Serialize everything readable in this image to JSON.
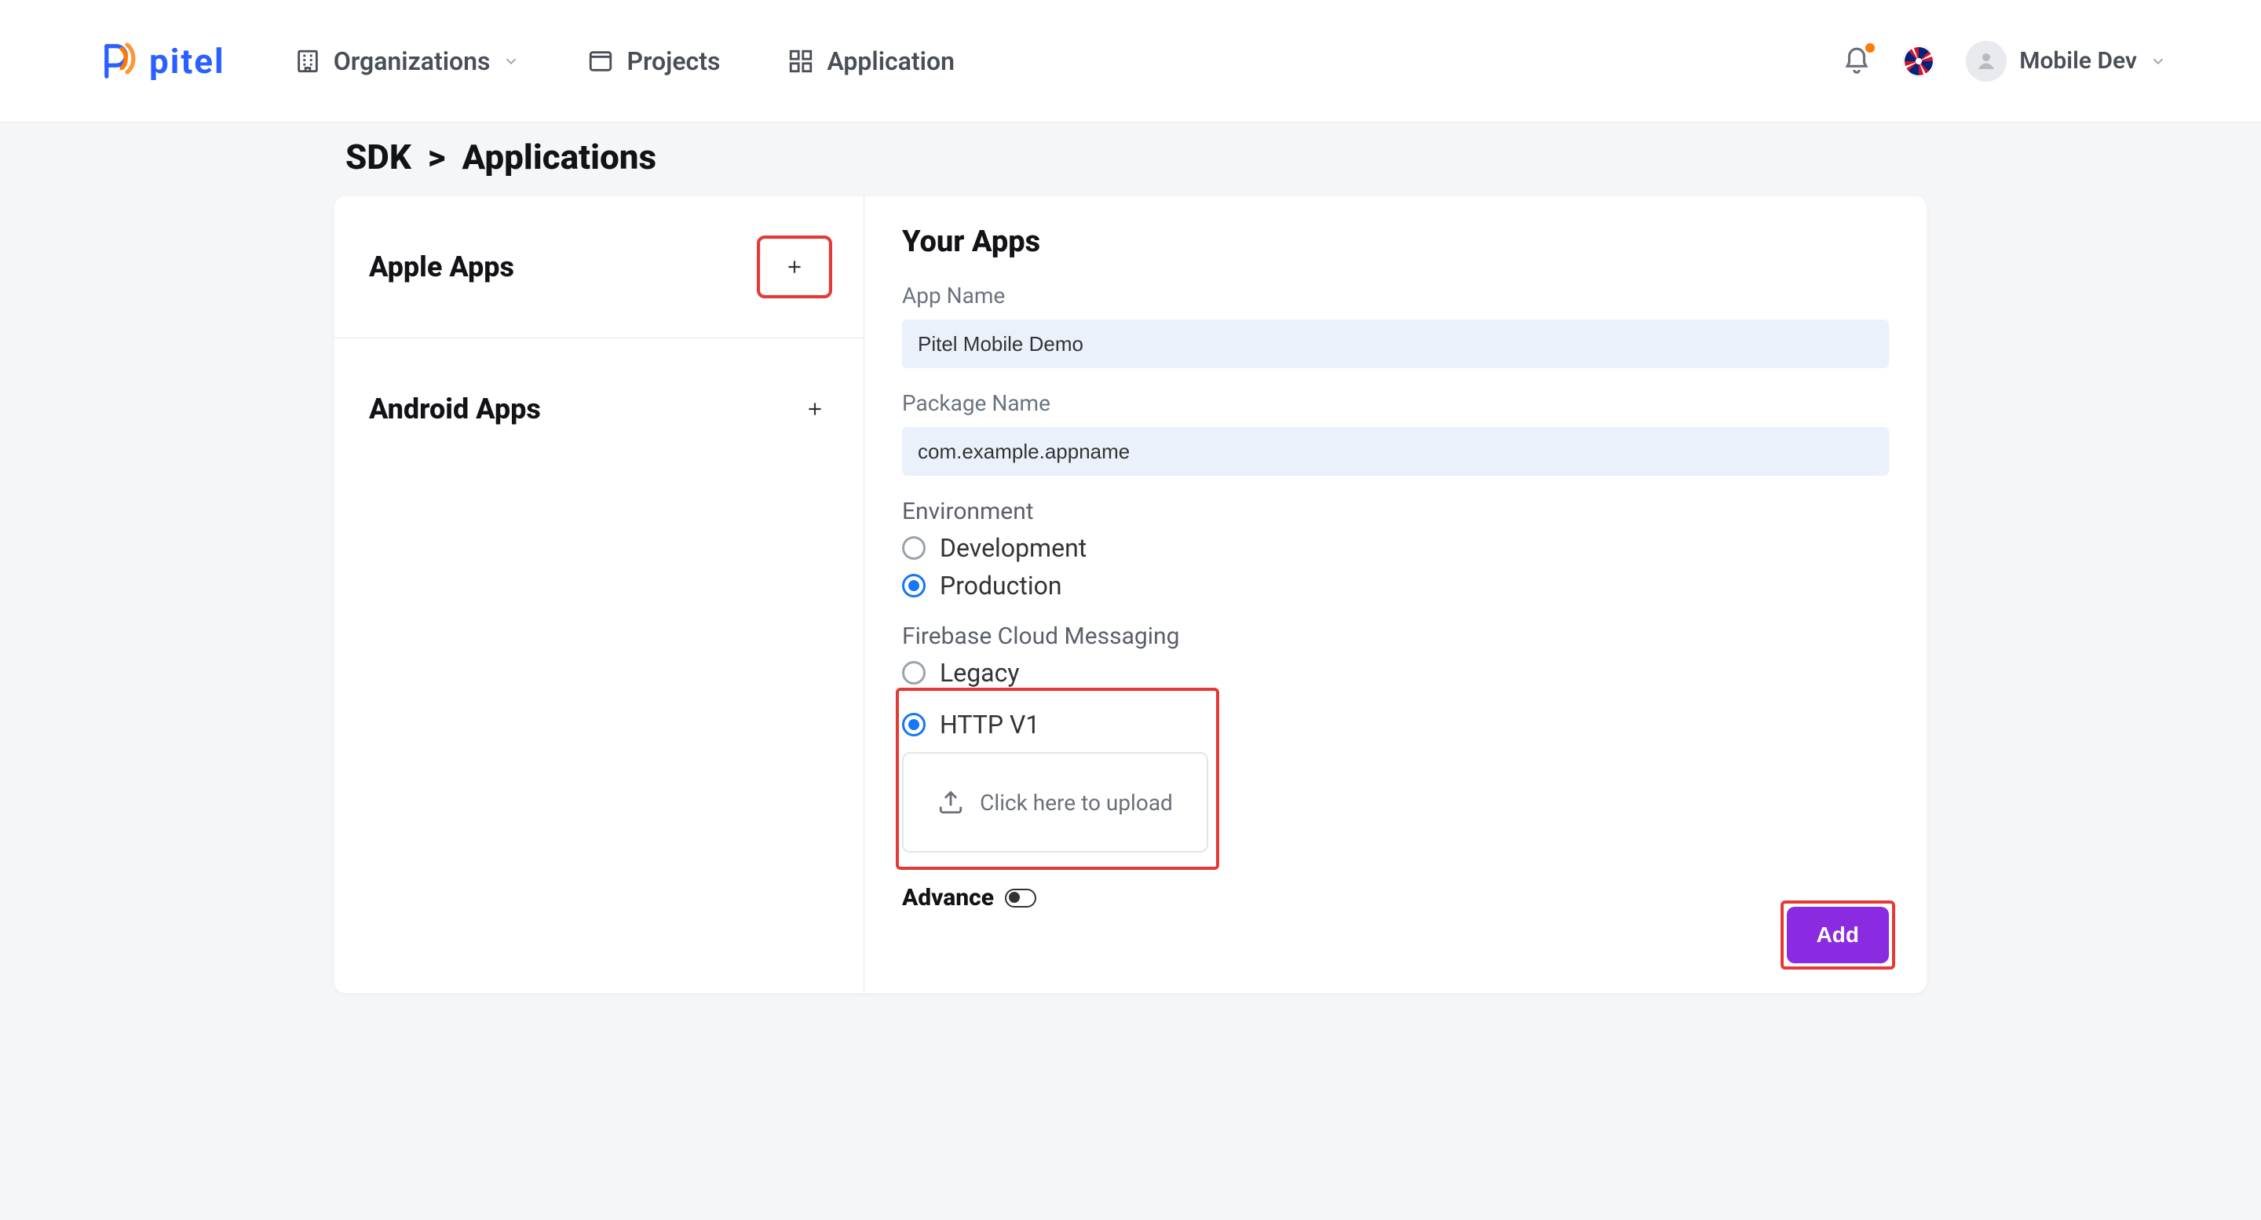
{
  "brand": {
    "name": "pitel"
  },
  "nav": {
    "organizations": "Organizations",
    "projects": "Projects",
    "application": "Application"
  },
  "user": {
    "display_name": "Mobile Dev"
  },
  "breadcrumb": {
    "root": "SDK",
    "separator": ">",
    "current": "Applications"
  },
  "left": {
    "apple_title": "Apple Apps",
    "android_title": "Android Apps"
  },
  "form": {
    "title": "Your Apps",
    "app_name_label": "App Name",
    "app_name_placeholder": "Pitel Mobile Demo",
    "app_name_value": "Pitel Mobile Demo",
    "package_label": "Package Name",
    "package_placeholder": "com.example.appname",
    "package_value": "com.example.appname",
    "environment_label": "Environment",
    "environment_options": {
      "development": "Development",
      "production": "Production"
    },
    "environment_selected": "production",
    "fcm_label": "Firebase Cloud Messaging",
    "fcm_options": {
      "legacy": "Legacy",
      "http_v1": "HTTP V1"
    },
    "fcm_selected": "http_v1",
    "upload_label": "Click here to upload",
    "advance_label": "Advance",
    "submit_label": "Add"
  },
  "colors": {
    "highlight": "#e53935",
    "accent_blue": "#1877F2",
    "purple": "#8a2be2"
  }
}
